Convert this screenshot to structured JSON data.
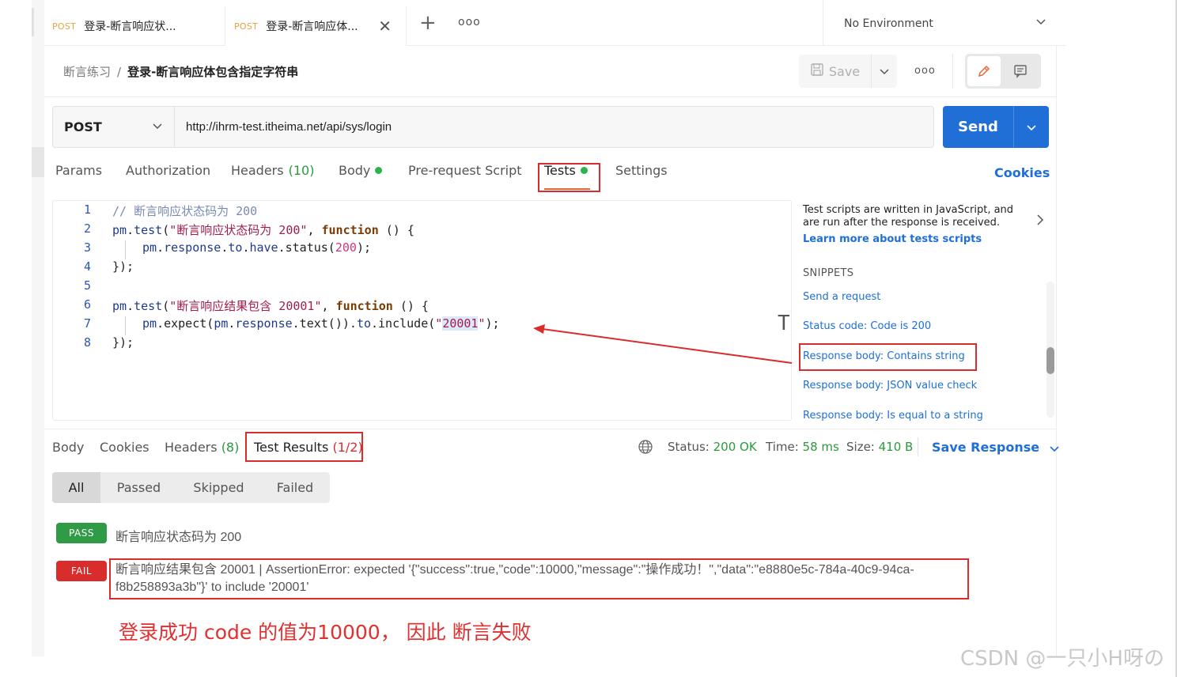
{
  "tabs": [
    {
      "method": "POST",
      "title": "登录-断言响应状..."
    },
    {
      "method": "POST",
      "title": "登录-断言响应体..."
    }
  ],
  "environment": "No Environment",
  "breadcrumb": {
    "parent": "断言练习",
    "separator": "/",
    "current": "登录-断言响应体包含指定字符串"
  },
  "save_label": "Save",
  "request": {
    "method": "POST",
    "url": "http://ihrm-test.itheima.net/api/sys/login"
  },
  "send_label": "Send",
  "request_tabs": {
    "params": "Params",
    "authorization": "Authorization",
    "headers": "Headers",
    "headers_count": "(10)",
    "body": "Body",
    "prerequest": "Pre-request Script",
    "tests": "Tests",
    "settings": "Settings",
    "cookies": "Cookies"
  },
  "code": {
    "line_numbers": [
      "1",
      "2",
      "3",
      "4",
      "5",
      "6",
      "7",
      "8"
    ],
    "l1": "// 断言响应状态码为 200",
    "l2_obj": "pm",
    "l2_dot": ".",
    "l2_fn": "test",
    "l2_open": "(",
    "l2_str": "\"断言响应状态码为 200\"",
    "l2_comma": ", ",
    "l2_kw": "function",
    "l2_rest": " () {",
    "l3_a": "pm",
    "l3_b": ".",
    "l3_c": "response",
    "l3_d": ".",
    "l3_e": "to",
    "l3_f": ".",
    "l3_g": "have",
    "l3_h": ".status(",
    "l3_num": "200",
    "l3_end": ");",
    "l4": "});",
    "l6_obj": "pm",
    "l6_dot": ".",
    "l6_fn": "test",
    "l6_open": "(",
    "l6_str": "\"断言响应结果包含 20001\"",
    "l6_comma": ", ",
    "l6_kw": "function",
    "l6_rest": " () {",
    "l7_a": "pm",
    "l7_b": ".expect(",
    "l7_c": "pm",
    "l7_d": ".",
    "l7_e": "response",
    "l7_f": ".text()).",
    "l7_g": "to",
    "l7_h": ".include(",
    "l7_q1": "\"",
    "l7_hl": "20001",
    "l7_q2": "\"",
    "l7_end": ");",
    "l8": "});"
  },
  "snippets": {
    "description": "Test scripts are written in JavaScript, and are run after the response is received.",
    "learn_more": "Learn more about tests scripts",
    "heading": "SNIPPETS",
    "items": [
      "Send a request",
      "Status code: Code is 200",
      "Response body: Contains string",
      "Response body: JSON value check",
      "Response body: Is equal to a string"
    ]
  },
  "response_tabs": {
    "body": "Body",
    "cookies": "Cookies",
    "headers": "Headers",
    "headers_count": "(8)",
    "test_results": "Test Results",
    "test_results_count": "(1/2)"
  },
  "status": {
    "status_label": "Status:",
    "status_value": "200 OK",
    "time_label": "Time:",
    "time_value": "58 ms",
    "size_label": "Size:",
    "size_value": "410 B"
  },
  "save_response": "Save Response",
  "filters": [
    "All",
    "Passed",
    "Skipped",
    "Failed"
  ],
  "results": [
    {
      "badge": "PASS",
      "text": "断言响应状态码为 200"
    },
    {
      "badge": "FAIL",
      "text": "断言响应结果包含 20001 | AssertionError: expected '{\"success\":true,\"code\":10000,\"message\":\"操作成功！\",\"data\":\"e8880e5c-784a-40c9-94ca-f8b258893a3b\"}' to include '20001'"
    }
  ],
  "annotation": "登录成功 code 的值为10000，  因此 断言失败",
  "watermark": "CSDN @一只小H呀の",
  "colors": {
    "accent": "#1f6fd6",
    "highlight_box": "#d92c2c",
    "pass": "#2f9b47",
    "fail": "#d92c2c",
    "method_post": "#e8a33b"
  },
  "icons": [
    "close-icon",
    "plus-icon",
    "more-icon",
    "chevron-down-icon",
    "save-icon",
    "edit-icon",
    "comment-icon",
    "globe-icon",
    "chevron-right-icon"
  ]
}
